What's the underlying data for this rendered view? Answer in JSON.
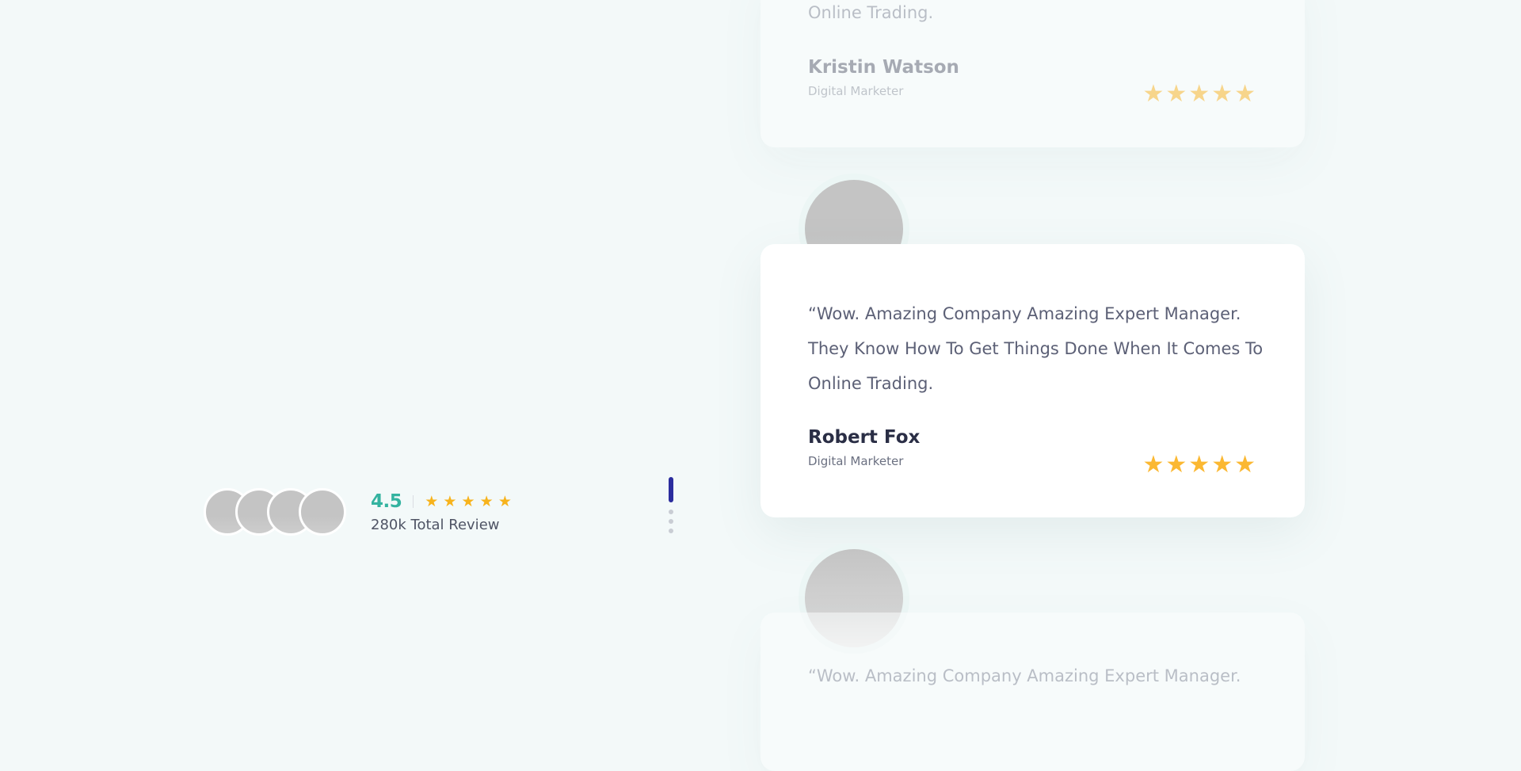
{
  "summary": {
    "rating": "4.5",
    "stars": [
      "★",
      "★",
      "★",
      "★",
      "★"
    ],
    "total_label": "280k Total Review"
  },
  "testimonials": [
    {
      "quote_tail": "Online Trading.",
      "name": "Kristin Watson",
      "role": "Digital Marketer",
      "stars": "★★★★★"
    },
    {
      "quote": "“Wow. Amazing Company Amazing Expert Manager. They Know How To Get Things Done When It Comes To Online Trading.",
      "name": "Robert Fox",
      "role": "Digital Marketer",
      "stars": "★★★★★"
    },
    {
      "quote_head": "“Wow. Amazing Company Amazing Expert Manager."
    }
  ],
  "colors": {
    "accent": "#34b3a0",
    "pager_active": "#2b2d9e",
    "star": "#fbb832",
    "background": "#f3f9f9"
  }
}
